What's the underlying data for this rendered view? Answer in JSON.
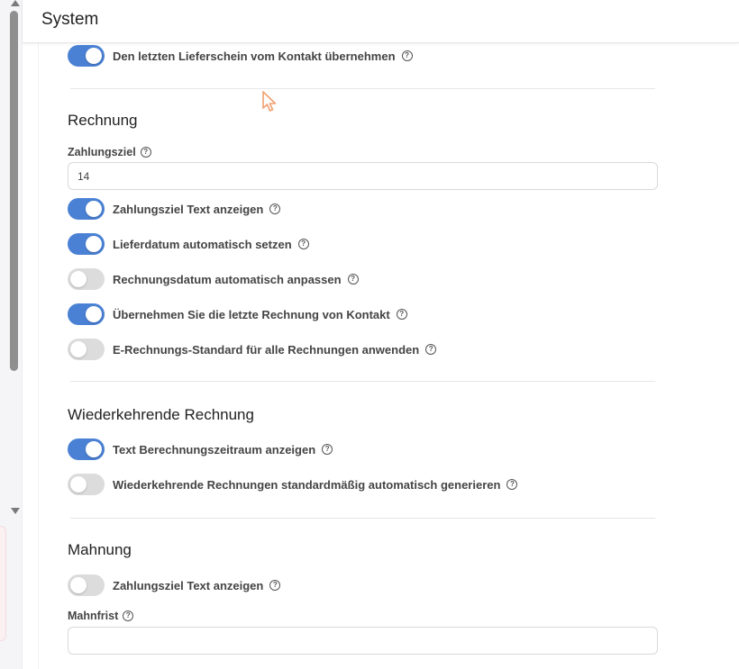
{
  "header": {
    "title": "System"
  },
  "lieferschein": {
    "toggles": [
      {
        "label": "Den letzten Lieferschein vom Kontakt übernehmen",
        "on": true
      }
    ]
  },
  "rechnung": {
    "title": "Rechnung",
    "zahlungsziel": {
      "label": "Zahlungsziel",
      "value": "14"
    },
    "toggles": [
      {
        "label": "Zahlungsziel Text anzeigen",
        "on": true
      },
      {
        "label": "Lieferdatum automatisch setzen",
        "on": true
      },
      {
        "label": "Rechnungsdatum automatisch anpassen",
        "on": false
      },
      {
        "label": "Übernehmen Sie die letzte Rechnung von Kontakt",
        "on": true
      },
      {
        "label": "E-Rechnungs-Standard für alle Rechnungen anwenden",
        "on": false
      }
    ]
  },
  "wiederkehrende": {
    "title": "Wiederkehrende Rechnung",
    "toggles": [
      {
        "label": "Text Berechnungszeitraum anzeigen",
        "on": true
      },
      {
        "label": "Wiederkehrende Rechnungen standardmäßig automatisch generieren",
        "on": false
      }
    ]
  },
  "mahnung": {
    "title": "Mahnung",
    "toggles": [
      {
        "label": "Zahlungsziel Text anzeigen",
        "on": false
      }
    ],
    "mahnfrist": {
      "label": "Mahnfrist",
      "value": ""
    }
  },
  "icons": {
    "help": "help-circle-icon",
    "cursor": "mouse-pointer-icon"
  },
  "colors": {
    "toggle_on": "#4a81d4",
    "toggle_off": "#dcdcdc",
    "cursor": "#f0a070"
  }
}
